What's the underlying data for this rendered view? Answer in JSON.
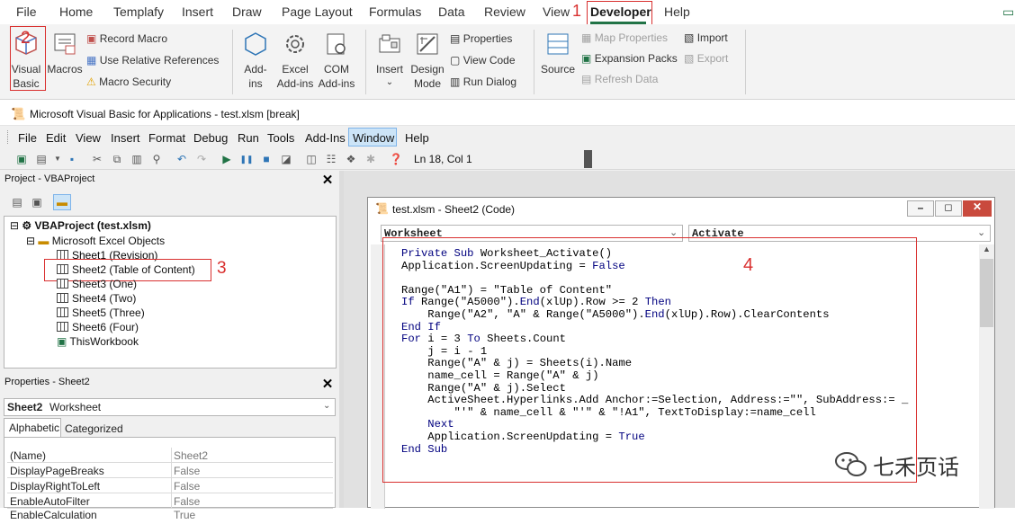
{
  "ribbon_tabs": [
    "File",
    "Home",
    "Templafy",
    "Insert",
    "Draw",
    "Page Layout",
    "Formulas",
    "Data",
    "Review",
    "View",
    "Developer",
    "Help"
  ],
  "active_tab": "Developer",
  "annotations": [
    "1",
    "2",
    "3",
    "4"
  ],
  "ribbon": {
    "visual_basic": "Visual Basic",
    "macros": "Macros",
    "record_macro": "Record Macro",
    "relative_refs": "Use Relative References",
    "macro_security": "Macro Security",
    "addins": "Add-ins",
    "excel_addins": "Excel Add-ins",
    "com_addins": "COM Add-ins",
    "insert": "Insert",
    "design_mode": "Design Mode",
    "properties": "Properties",
    "view_code": "View Code",
    "run_dialog": "Run Dialog",
    "source": "Source",
    "map_properties": "Map Properties",
    "expansion_packs": "Expansion Packs",
    "refresh_data": "Refresh Data",
    "import": "Import",
    "export": "Export"
  },
  "vba": {
    "title": "Microsoft Visual Basic for Applications - test.xlsm [break]",
    "menus": [
      "File",
      "Edit",
      "View",
      "Insert",
      "Format",
      "Debug",
      "Run",
      "Tools",
      "Add-Ins",
      "Window",
      "Help"
    ],
    "active_menu": "Window",
    "status": "Ln 18, Col 1",
    "project_title": "Project - VBAProject",
    "project_root": "VBAProject (test.xlsm)",
    "folder": "Microsoft Excel Objects",
    "sheets": [
      "Sheet1 (Revision)",
      "Sheet2 (Table of Content)",
      "Sheet3 (One)",
      "Sheet4 (Two)",
      "Sheet5 (Three)",
      "Sheet6 (Four)",
      "ThisWorkbook"
    ],
    "properties_title": "Properties - Sheet2",
    "properties_object": "Sheet2",
    "properties_object_type": "Worksheet",
    "prop_tabs": [
      "Alphabetic",
      "Categorized"
    ],
    "props": [
      [
        "(Name)",
        "Sheet2"
      ],
      [
        "DisplayPageBreaks",
        "False"
      ],
      [
        "DisplayRightToLeft",
        "False"
      ],
      [
        "EnableAutoFilter",
        "False"
      ],
      [
        "EnableCalculation",
        "True"
      ]
    ],
    "code_title": "test.xlsm - Sheet2 (Code)",
    "object_dropdown": "Worksheet",
    "proc_dropdown": "Activate",
    "code_lines": [
      "Private Sub Worksheet_Activate()",
      "Application.ScreenUpdating = False",
      "",
      "Range(\"A1\") = \"Table of Content\"",
      "If Range(\"A5000\").End(xlUp).Row >= 2 Then",
      "    Range(\"A2\", \"A\" & Range(\"A5000\").End(xlUp).Row).ClearContents",
      "End If",
      "For i = 3 To Sheets.Count",
      "    j = i - 1",
      "    Range(\"A\" & j) = Sheets(i).Name",
      "    name_cell = Range(\"A\" & j)",
      "    Range(\"A\" & j).Select",
      "    ActiveSheet.Hyperlinks.Add Anchor:=Selection, Address:=\"\", SubAddress:= _",
      "        \"'\" & name_cell & \"'\" & \"!A1\", TextToDisplay:=name_cell",
      "    Next",
      "    Application.ScreenUpdating = True",
      "End Sub"
    ],
    "watermark": "七禾页话"
  },
  "colors": {
    "annotation_red": "#d9302f",
    "code_keyword": "#00007f",
    "developer_green": "#217346"
  }
}
